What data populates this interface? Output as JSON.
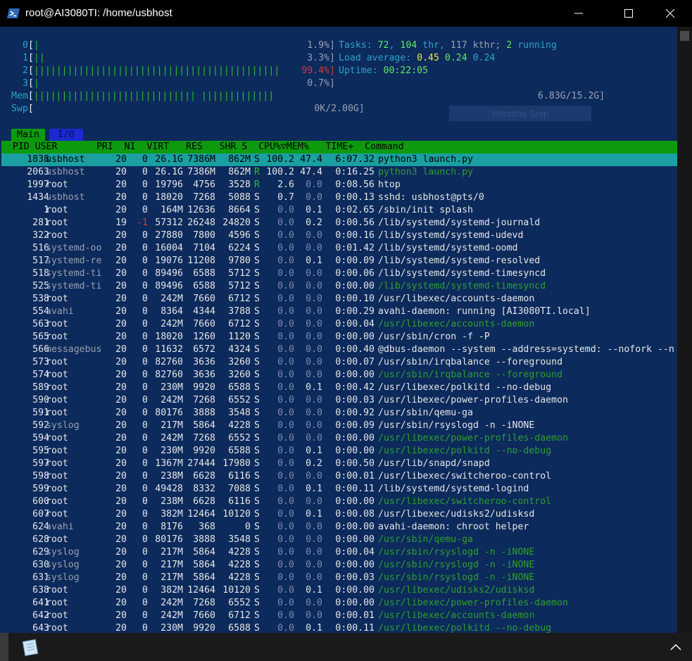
{
  "window": {
    "title": "root@AI3080TI: /home/usbhost"
  },
  "cpu": [
    {
      "id": "0",
      "bars": "|",
      "pct": "1.9%]"
    },
    {
      "id": "1",
      "bars": "||",
      "pct": "3.3%]"
    },
    {
      "id": "2",
      "bars": "||||||||||||||||||||||||||||||||||||||||||||",
      "pct": "99.4%]"
    },
    {
      "id": "3",
      "bars": "|",
      "pct": "0.7%]"
    }
  ],
  "mem": {
    "label": "Mem",
    "bars": "||||||||||||||||||||||||||||| |||||||||||||",
    "val": "6.83G/15.2G]"
  },
  "swp": {
    "label": "Swp",
    "val": "0K/2.00G]"
  },
  "summary": {
    "tasks_label": "Tasks:",
    "tasks": "72",
    "thr": "104",
    "thr_label": "thr,",
    "kthr": "117 kthr;",
    "running": "2",
    "running_label": "running",
    "load_label": "Load average:",
    "load1": "0.45",
    "load5": "0.24",
    "load15": "0.24",
    "uptime_label": "Uptime:",
    "uptime": "00:22:05"
  },
  "overlay": {
    "snip": "Window Snip"
  },
  "tabs": {
    "main": "Main",
    "io": "I/O"
  },
  "columns": "  PID USER       PRI  NI  VIRT   RES   SHR S  CPU%▽MEM%   TIME+  Command",
  "rows": [
    {
      "pid": "1838",
      "user": "usbhost",
      "pri": "20",
      "ni": "0",
      "virt": "26.1G",
      "res": "7386M",
      "shr": "862M",
      "s": "S",
      "cpu": "100.2",
      "mem": "47.4",
      "time": "6:07.32",
      "cmd": "python3 launch.py",
      "thread": false,
      "selected": true
    },
    {
      "pid": "2063",
      "user": "usbhost",
      "pri": "20",
      "ni": "0",
      "virt": "26.1G",
      "res": "7386M",
      "shr": "862M",
      "s": "R",
      "cpu": "100.2",
      "mem": "47.4",
      "time": "0:16.25",
      "cmd": "python3 launch.py",
      "thread": true
    },
    {
      "pid": "1997",
      "user": "root",
      "pri": "20",
      "ni": "0",
      "virt": "19796",
      "res": "4756",
      "shr": "3528",
      "s": "R",
      "cpu": "2.6",
      "mem": "0.0",
      "time": "0:08.56",
      "cmd": "htop",
      "thread": false
    },
    {
      "pid": "1434",
      "user": "usbhost",
      "pri": "20",
      "ni": "0",
      "virt": "18020",
      "res": "7268",
      "shr": "5088",
      "s": "S",
      "cpu": "0.7",
      "mem": "0.0",
      "time": "0:00.13",
      "cmd": "sshd: usbhost@pts/0",
      "thread": false
    },
    {
      "pid": "1",
      "user": "root",
      "pri": "20",
      "ni": "0",
      "virt": "164M",
      "res": "12636",
      "shr": "8664",
      "s": "S",
      "cpu": "0.0",
      "mem": "0.1",
      "time": "0:02.65",
      "cmd": "/sbin/init splash",
      "thread": false
    },
    {
      "pid": "281",
      "user": "root",
      "pri": "19",
      "ni": "-1",
      "virt": "57312",
      "res": "26248",
      "shr": "24820",
      "s": "S",
      "cpu": "0.0",
      "mem": "0.2",
      "time": "0:00.56",
      "cmd": "/lib/systemd/systemd-journald",
      "thread": false
    },
    {
      "pid": "322",
      "user": "root",
      "pri": "20",
      "ni": "0",
      "virt": "27880",
      "res": "7800",
      "shr": "4596",
      "s": "S",
      "cpu": "0.0",
      "mem": "0.0",
      "time": "0:00.16",
      "cmd": "/lib/systemd/systemd-udevd",
      "thread": false
    },
    {
      "pid": "516",
      "user": "systemd-oo",
      "pri": "20",
      "ni": "0",
      "virt": "16004",
      "res": "7104",
      "shr": "6224",
      "s": "S",
      "cpu": "0.0",
      "mem": "0.0",
      "time": "0:01.42",
      "cmd": "/lib/systemd/systemd-oomd",
      "thread": false
    },
    {
      "pid": "517",
      "user": "systemd-re",
      "pri": "20",
      "ni": "0",
      "virt": "19076",
      "res": "11208",
      "shr": "9780",
      "s": "S",
      "cpu": "0.0",
      "mem": "0.1",
      "time": "0:00.09",
      "cmd": "/lib/systemd/systemd-resolved",
      "thread": false
    },
    {
      "pid": "518",
      "user": "systemd-ti",
      "pri": "20",
      "ni": "0",
      "virt": "89496",
      "res": "6588",
      "shr": "5712",
      "s": "S",
      "cpu": "0.0",
      "mem": "0.0",
      "time": "0:00.06",
      "cmd": "/lib/systemd/systemd-timesyncd",
      "thread": false
    },
    {
      "pid": "525",
      "user": "systemd-ti",
      "pri": "20",
      "ni": "0",
      "virt": "89496",
      "res": "6588",
      "shr": "5712",
      "s": "S",
      "cpu": "0.0",
      "mem": "0.0",
      "time": "0:00.00",
      "cmd": "/lib/systemd/systemd-timesyncd",
      "thread": true
    },
    {
      "pid": "538",
      "user": "root",
      "pri": "20",
      "ni": "0",
      "virt": "242M",
      "res": "7660",
      "shr": "6712",
      "s": "S",
      "cpu": "0.0",
      "mem": "0.0",
      "time": "0:00.10",
      "cmd": "/usr/libexec/accounts-daemon",
      "thread": false
    },
    {
      "pid": "554",
      "user": "avahi",
      "pri": "20",
      "ni": "0",
      "virt": "8364",
      "res": "4344",
      "shr": "3788",
      "s": "S",
      "cpu": "0.0",
      "mem": "0.0",
      "time": "0:00.29",
      "cmd": "avahi-daemon: running [AI3080TI.local]",
      "thread": false
    },
    {
      "pid": "563",
      "user": "root",
      "pri": "20",
      "ni": "0",
      "virt": "242M",
      "res": "7660",
      "shr": "6712",
      "s": "S",
      "cpu": "0.0",
      "mem": "0.0",
      "time": "0:00.04",
      "cmd": "/usr/libexec/accounts-daemon",
      "thread": true
    },
    {
      "pid": "565",
      "user": "root",
      "pri": "20",
      "ni": "0",
      "virt": "18020",
      "res": "1260",
      "shr": "1120",
      "s": "S",
      "cpu": "0.0",
      "mem": "0.0",
      "time": "0:00.00",
      "cmd": "/usr/sbin/cron -f -P",
      "thread": false
    },
    {
      "pid": "566",
      "user": "messagebus",
      "pri": "20",
      "ni": "0",
      "virt": "11632",
      "res": "6572",
      "shr": "4324",
      "s": "S",
      "cpu": "0.0",
      "mem": "0.0",
      "time": "0:00.40",
      "cmd": "@dbus-daemon --system --address=systemd: --nofork --n",
      "thread": false
    },
    {
      "pid": "573",
      "user": "root",
      "pri": "20",
      "ni": "0",
      "virt": "82760",
      "res": "3636",
      "shr": "3260",
      "s": "S",
      "cpu": "0.0",
      "mem": "0.0",
      "time": "0:00.07",
      "cmd": "/usr/sbin/irqbalance --foreground",
      "thread": false
    },
    {
      "pid": "574",
      "user": "root",
      "pri": "20",
      "ni": "0",
      "virt": "82760",
      "res": "3636",
      "shr": "3260",
      "s": "S",
      "cpu": "0.0",
      "mem": "0.0",
      "time": "0:00.00",
      "cmd": "/usr/sbin/irqbalance --foreground",
      "thread": true
    },
    {
      "pid": "589",
      "user": "root",
      "pri": "20",
      "ni": "0",
      "virt": "230M",
      "res": "9920",
      "shr": "6588",
      "s": "S",
      "cpu": "0.0",
      "mem": "0.1",
      "time": "0:00.42",
      "cmd": "/usr/libexec/polkitd --no-debug",
      "thread": false
    },
    {
      "pid": "590",
      "user": "root",
      "pri": "20",
      "ni": "0",
      "virt": "242M",
      "res": "7268",
      "shr": "6552",
      "s": "S",
      "cpu": "0.0",
      "mem": "0.0",
      "time": "0:00.03",
      "cmd": "/usr/libexec/power-profiles-daemon",
      "thread": false
    },
    {
      "pid": "591",
      "user": "root",
      "pri": "20",
      "ni": "0",
      "virt": "80176",
      "res": "3888",
      "shr": "3548",
      "s": "S",
      "cpu": "0.0",
      "mem": "0.0",
      "time": "0:00.92",
      "cmd": "/usr/sbin/qemu-ga",
      "thread": false
    },
    {
      "pid": "592",
      "user": "syslog",
      "pri": "20",
      "ni": "0",
      "virt": "217M",
      "res": "5864",
      "shr": "4228",
      "s": "S",
      "cpu": "0.0",
      "mem": "0.0",
      "time": "0:00.09",
      "cmd": "/usr/sbin/rsyslogd -n -iNONE",
      "thread": false
    },
    {
      "pid": "594",
      "user": "root",
      "pri": "20",
      "ni": "0",
      "virt": "242M",
      "res": "7268",
      "shr": "6552",
      "s": "S",
      "cpu": "0.0",
      "mem": "0.0",
      "time": "0:00.00",
      "cmd": "/usr/libexec/power-profiles-daemon",
      "thread": true
    },
    {
      "pid": "595",
      "user": "root",
      "pri": "20",
      "ni": "0",
      "virt": "230M",
      "res": "9920",
      "shr": "6588",
      "s": "S",
      "cpu": "0.0",
      "mem": "0.1",
      "time": "0:00.00",
      "cmd": "/usr/libexec/polkitd --no-debug",
      "thread": true
    },
    {
      "pid": "597",
      "user": "root",
      "pri": "20",
      "ni": "0",
      "virt": "1367M",
      "res": "27444",
      "shr": "17980",
      "s": "S",
      "cpu": "0.0",
      "mem": "0.2",
      "time": "0:00.50",
      "cmd": "/usr/lib/snapd/snapd",
      "thread": false
    },
    {
      "pid": "598",
      "user": "root",
      "pri": "20",
      "ni": "0",
      "virt": "238M",
      "res": "6628",
      "shr": "6116",
      "s": "S",
      "cpu": "0.0",
      "mem": "0.0",
      "time": "0:00.01",
      "cmd": "/usr/libexec/switcheroo-control",
      "thread": false
    },
    {
      "pid": "599",
      "user": "root",
      "pri": "20",
      "ni": "0",
      "virt": "49428",
      "res": "8332",
      "shr": "7088",
      "s": "S",
      "cpu": "0.0",
      "mem": "0.1",
      "time": "0:00.11",
      "cmd": "/lib/systemd/systemd-logind",
      "thread": false
    },
    {
      "pid": "600",
      "user": "root",
      "pri": "20",
      "ni": "0",
      "virt": "238M",
      "res": "6628",
      "shr": "6116",
      "s": "S",
      "cpu": "0.0",
      "mem": "0.0",
      "time": "0:00.00",
      "cmd": "/usr/libexec/switcheroo-control",
      "thread": true
    },
    {
      "pid": "607",
      "user": "root",
      "pri": "20",
      "ni": "0",
      "virt": "382M",
      "res": "12464",
      "shr": "10120",
      "s": "S",
      "cpu": "0.0",
      "mem": "0.1",
      "time": "0:00.08",
      "cmd": "/usr/libexec/udisks2/udisksd",
      "thread": false
    },
    {
      "pid": "624",
      "user": "avahi",
      "pri": "20",
      "ni": "0",
      "virt": "8176",
      "res": "368",
      "shr": "0",
      "s": "S",
      "cpu": "0.0",
      "mem": "0.0",
      "time": "0:00.00",
      "cmd": "avahi-daemon: chroot helper",
      "thread": false
    },
    {
      "pid": "628",
      "user": "root",
      "pri": "20",
      "ni": "0",
      "virt": "80176",
      "res": "3888",
      "shr": "3548",
      "s": "S",
      "cpu": "0.0",
      "mem": "0.0",
      "time": "0:00.00",
      "cmd": "/usr/sbin/qemu-ga",
      "thread": true
    },
    {
      "pid": "629",
      "user": "syslog",
      "pri": "20",
      "ni": "0",
      "virt": "217M",
      "res": "5864",
      "shr": "4228",
      "s": "S",
      "cpu": "0.0",
      "mem": "0.0",
      "time": "0:00.04",
      "cmd": "/usr/sbin/rsyslogd -n -iNONE",
      "thread": true
    },
    {
      "pid": "630",
      "user": "syslog",
      "pri": "20",
      "ni": "0",
      "virt": "217M",
      "res": "5864",
      "shr": "4228",
      "s": "S",
      "cpu": "0.0",
      "mem": "0.0",
      "time": "0:00.00",
      "cmd": "/usr/sbin/rsyslogd -n -iNONE",
      "thread": true
    },
    {
      "pid": "631",
      "user": "syslog",
      "pri": "20",
      "ni": "0",
      "virt": "217M",
      "res": "5864",
      "shr": "4228",
      "s": "S",
      "cpu": "0.0",
      "mem": "0.0",
      "time": "0:00.03",
      "cmd": "/usr/sbin/rsyslogd -n -iNONE",
      "thread": true
    },
    {
      "pid": "638",
      "user": "root",
      "pri": "20",
      "ni": "0",
      "virt": "382M",
      "res": "12464",
      "shr": "10120",
      "s": "S",
      "cpu": "0.0",
      "mem": "0.1",
      "time": "0:00.00",
      "cmd": "/usr/libexec/udisks2/udisksd",
      "thread": true
    },
    {
      "pid": "641",
      "user": "root",
      "pri": "20",
      "ni": "0",
      "virt": "242M",
      "res": "7268",
      "shr": "6552",
      "s": "S",
      "cpu": "0.0",
      "mem": "0.0",
      "time": "0:00.00",
      "cmd": "/usr/libexec/power-profiles-daemon",
      "thread": true
    },
    {
      "pid": "642",
      "user": "root",
      "pri": "20",
      "ni": "0",
      "virt": "242M",
      "res": "7660",
      "shr": "6712",
      "s": "S",
      "cpu": "0.0",
      "mem": "0.0",
      "time": "0:00.01",
      "cmd": "/usr/libexec/accounts-daemon",
      "thread": true
    },
    {
      "pid": "643",
      "user": "root",
      "pri": "20",
      "ni": "0",
      "virt": "230M",
      "res": "9920",
      "shr": "6588",
      "s": "S",
      "cpu": "0.0",
      "mem": "0.1",
      "time": "0:00.11",
      "cmd": "/usr/libexec/polkitd --no-debug",
      "thread": true
    }
  ]
}
